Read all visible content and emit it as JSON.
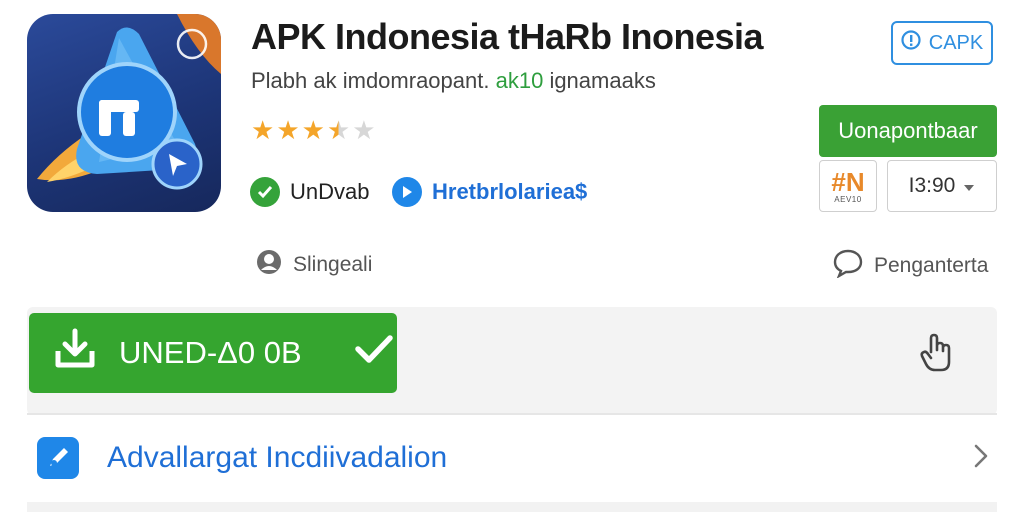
{
  "app": {
    "title": "APK Indonesia tHaRb Inonesia",
    "subtitle_main": "Plabh ak imdomraopant.",
    "subtitle_accent": "ak10",
    "subtitle_tail": "ignamaaks",
    "rating": 3.5,
    "rating_max": 5
  },
  "tags": [
    {
      "label": "UnDvab",
      "icon": "check-badge-icon",
      "color": "#35a33a"
    },
    {
      "label": "Hretbrlolariea$",
      "icon": "arrow-badge-icon",
      "color": "#1f87e8"
    }
  ],
  "meta": {
    "left_label": "Slingeali",
    "left_icon": "user-icon",
    "right_label": "Penganterta",
    "right_icon": "chat-bubble-icon"
  },
  "badge": {
    "label": "CAPK",
    "icon": "info-icon"
  },
  "install": {
    "label": "Uonapontbaar"
  },
  "publisher": {
    "glyph": "#N",
    "caption": "AEV10"
  },
  "version": {
    "value": "I3:90"
  },
  "download": {
    "label": "UNED-Δ0 0B"
  },
  "link": {
    "label": "Advallargat Incdiivadalion",
    "icon": "pen-icon"
  },
  "colors": {
    "accent_green": "#35a52f",
    "accent_blue": "#1f87e8",
    "star": "#f4a52a"
  }
}
